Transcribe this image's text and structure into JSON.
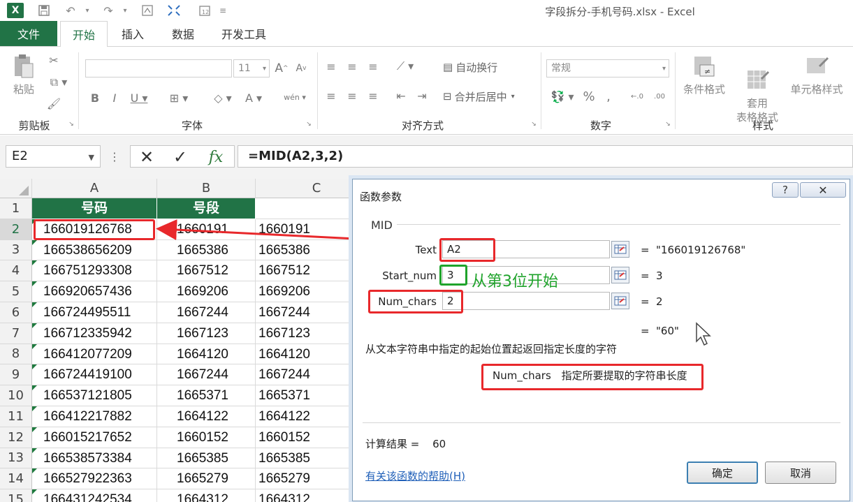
{
  "window": {
    "title": "字段拆分-手机号码.xlsx - Excel"
  },
  "quick_access": {
    "save_icon": "save-icon",
    "undo_icon": "undo-icon",
    "redo_icon": "redo-icon"
  },
  "tabs": [
    "文件",
    "开始",
    "插入",
    "数据",
    "开发工具"
  ],
  "ribbon": {
    "clipboard": {
      "paste_label": "粘贴",
      "group_label": "剪贴板"
    },
    "font": {
      "font_name": "",
      "font_size": "11",
      "group_label": "字体"
    },
    "alignment": {
      "wrap_text": "自动换行",
      "merge_center": "合并后居中",
      "group_label": "对齐方式"
    },
    "number": {
      "format": "常规",
      "group_label": "数字"
    },
    "styles": {
      "conditional": "条件格式",
      "table_format": "套用\n表格格式",
      "cell_style": "单元格样式",
      "group_label": "样式"
    }
  },
  "formula_bar": {
    "name_box": "E2",
    "formula": "=MID(A2,3,2)",
    "fx": "fx"
  },
  "sheet": {
    "columns": [
      "A",
      "B",
      "C"
    ],
    "header_row": [
      "号码",
      "号段",
      ""
    ],
    "rows": [
      [
        "166019126768",
        "1660191",
        "1660191"
      ],
      [
        "166538656209",
        "1665386",
        "1665386"
      ],
      [
        "166751293308",
        "1667512",
        "1667512"
      ],
      [
        "166920657436",
        "1669206",
        "1669206"
      ],
      [
        "166724495511",
        "1667244",
        "1667244"
      ],
      [
        "166712335942",
        "1667123",
        "1667123"
      ],
      [
        "166412077209",
        "1664120",
        "1664120"
      ],
      [
        "166724419100",
        "1667244",
        "1667244"
      ],
      [
        "166537121805",
        "1665371",
        "1665371"
      ],
      [
        "166412217882",
        "1664122",
        "1664122"
      ],
      [
        "166015217652",
        "1660152",
        "1660152"
      ],
      [
        "166538573384",
        "1665385",
        "1665385"
      ],
      [
        "166527922363",
        "1665279",
        "1665279"
      ],
      [
        "166431242534",
        "1664312",
        "1664312"
      ]
    ],
    "row_numbers": [
      "1",
      "2",
      "3",
      "4",
      "5",
      "6",
      "7",
      "8",
      "9",
      "10",
      "11",
      "12",
      "13",
      "14",
      "15"
    ]
  },
  "dialog": {
    "title": "函数参数",
    "help_btn": "?",
    "close_btn": "✕",
    "function_name": "MID",
    "args": [
      {
        "label": "Text",
        "value": "A2",
        "result": "\"166019126768\""
      },
      {
        "label": "Start_num",
        "value": "3",
        "result": "3"
      },
      {
        "label": "Num_chars",
        "value": "2",
        "result": "2"
      }
    ],
    "formula_result_preview": "\"60\"",
    "eq": "=",
    "description": "从文本字符串中指定的起始位置起返回指定长度的字符",
    "param_name": "Num_chars",
    "param_desc": "指定所要提取的字符串长度",
    "result_label": "计算结果 =",
    "result_value": "60",
    "help_link": "有关该函数的帮助(H)",
    "ok_label": "确定",
    "cancel_label": "取消"
  },
  "annotation": {
    "start_hint": "从第3位开始"
  },
  "colors": {
    "excel_green": "#217346",
    "annotation_red": "#e8282b",
    "annotation_green": "#1fa32b"
  }
}
